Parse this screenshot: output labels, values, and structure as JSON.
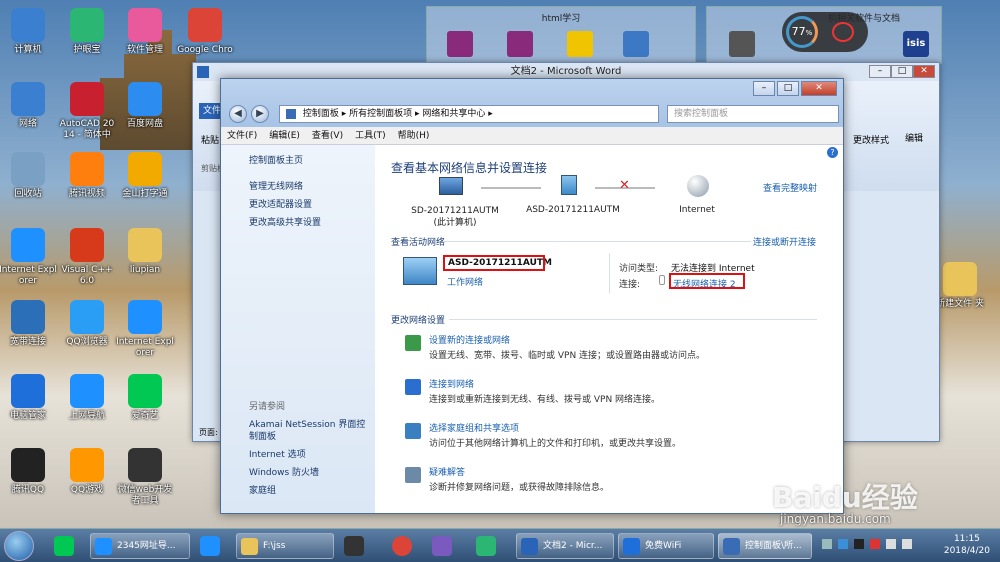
{
  "desktop": {
    "icons": [
      {
        "label": "计算机",
        "icon": "computer-icon",
        "color": "#3b7fd0"
      },
      {
        "label": "护眼宝",
        "icon": "eye-protect-icon",
        "color": "#2bb673"
      },
      {
        "label": "软件管理",
        "icon": "software-manager-icon",
        "color": "#e85a9b"
      },
      {
        "label": "Google Chro",
        "icon": "chrome-icon",
        "color": "#db4437"
      },
      {
        "label": "网络",
        "icon": "network-icon",
        "color": "#3b7fd0"
      },
      {
        "label": "AutoCAD 20 14 - 简体中",
        "icon": "autocad-icon",
        "color": "#c8202f"
      },
      {
        "label": "百度网盘",
        "icon": "baidu-netdisk-icon",
        "color": "#2d8cf0"
      },
      {
        "label": "回收站",
        "icon": "recycle-bin-icon",
        "color": "#7aa0c4"
      },
      {
        "label": "腾讯视频",
        "icon": "tencent-video-icon",
        "color": "#ff7f0e"
      },
      {
        "label": "金山打字通",
        "icon": "typing-icon",
        "color": "#f2a900"
      },
      {
        "label": "Internet Expl orer",
        "icon": "ie-icon",
        "color": "#1e90ff"
      },
      {
        "label": "Visual C++ 6.0",
        "icon": "vc-icon",
        "color": "#d63a1a"
      },
      {
        "label": "liupian",
        "icon": "folder-icon",
        "color": "#e8c45a"
      },
      {
        "label": "宽带连接",
        "icon": "broadband-icon",
        "color": "#2a6fb8"
      },
      {
        "label": "QQ浏览器",
        "icon": "qq-browser-icon",
        "color": "#2a9df4"
      },
      {
        "label": "Internet Expl orer",
        "icon": "ie-icon",
        "color": "#1e90ff"
      },
      {
        "label": "电脑管家",
        "icon": "pc-manager-icon",
        "color": "#1e6fd9"
      },
      {
        "label": "上网导航",
        "icon": "ie-icon",
        "color": "#1e90ff"
      },
      {
        "label": "爱奇艺",
        "icon": "iqiyi-icon",
        "color": "#00c853"
      },
      {
        "label": "腾讯QQ",
        "icon": "qq-icon",
        "color": "#222"
      },
      {
        "label": "QQ游戏",
        "icon": "qq-game-icon",
        "color": "#ff9800"
      },
      {
        "label": "微信web开发 者工具",
        "icon": "wechat-devtools-icon",
        "color": "#333"
      }
    ],
    "right_folder": "新建文件 夹",
    "bg_window1_title": "html学习",
    "bg_window2_title": "机相关软件与文档"
  },
  "gauge": {
    "value": "77",
    "unit": "%"
  },
  "word": {
    "title": "文档2 - Microsoft Word",
    "file_tab": "文件",
    "paste": "粘贴",
    "clipboard": "剪贴板",
    "change_style": "更改样式",
    "edit": "编辑",
    "page_label": "页面:"
  },
  "cp": {
    "breadcrumb": [
      "控制面板",
      "所有控制面板项",
      "网络和共享中心"
    ],
    "search_placeholder": "搜索控制面板",
    "menu": [
      "文件(F)",
      "编辑(E)",
      "查看(V)",
      "工具(T)",
      "帮助(H)"
    ],
    "sidebar": {
      "home": "控制面板主页",
      "links": [
        "管理无线网络",
        "更改适配器设置",
        "更改高级共享设置"
      ],
      "see_also": "另请参阅",
      "see_also_links": [
        "Akamai NetSession 界面控制面板",
        "Internet 选项",
        "Windows 防火墙",
        "家庭组"
      ]
    },
    "main": {
      "heading": "查看基本网络信息并设置连接",
      "full_map": "查看完整映射",
      "node1_name": "SD-20171211AUTM",
      "node1_sub": "(此计算机)",
      "node2_name": "ASD-20171211AUTM",
      "node3_name": "Internet",
      "active_title": "查看活动网络",
      "connect_disconnect": "连接或断开连接",
      "net_name": "ASD-20171211AUTM",
      "net_type": "工作网络",
      "access_label": "访问类型:",
      "access_value": "无法连接到 Internet",
      "conn_label": "连接:",
      "conn_value": "无线网络连接 2",
      "change_title": "更改网络设置",
      "tasks": [
        {
          "title": "设置新的连接或网络",
          "desc": "设置无线、宽带、拨号、临时或 VPN 连接；或设置路由器或访问点。",
          "icon": "new-connection-icon"
        },
        {
          "title": "连接到网络",
          "desc": "连接到或重新连接到无线、有线、拨号或 VPN 网络连接。",
          "icon": "connect-network-icon"
        },
        {
          "title": "选择家庭组和共享选项",
          "desc": "访问位于其他网络计算机上的文件和打印机，或更改共享设置。",
          "icon": "homegroup-icon"
        },
        {
          "title": "疑难解答",
          "desc": "诊断并修复网络问题，或获得故障排除信息。",
          "icon": "troubleshoot-icon"
        }
      ]
    }
  },
  "taskbar": {
    "buttons": [
      "2345网址导...",
      "F:\\jss",
      "文档2 - Micr...",
      "免费WiFi",
      "控制面板\\所..."
    ],
    "time": "11:15",
    "date": "2018/4/20"
  },
  "watermark": {
    "brand": "Baidu经验",
    "url": "jingyan.baidu.com"
  }
}
